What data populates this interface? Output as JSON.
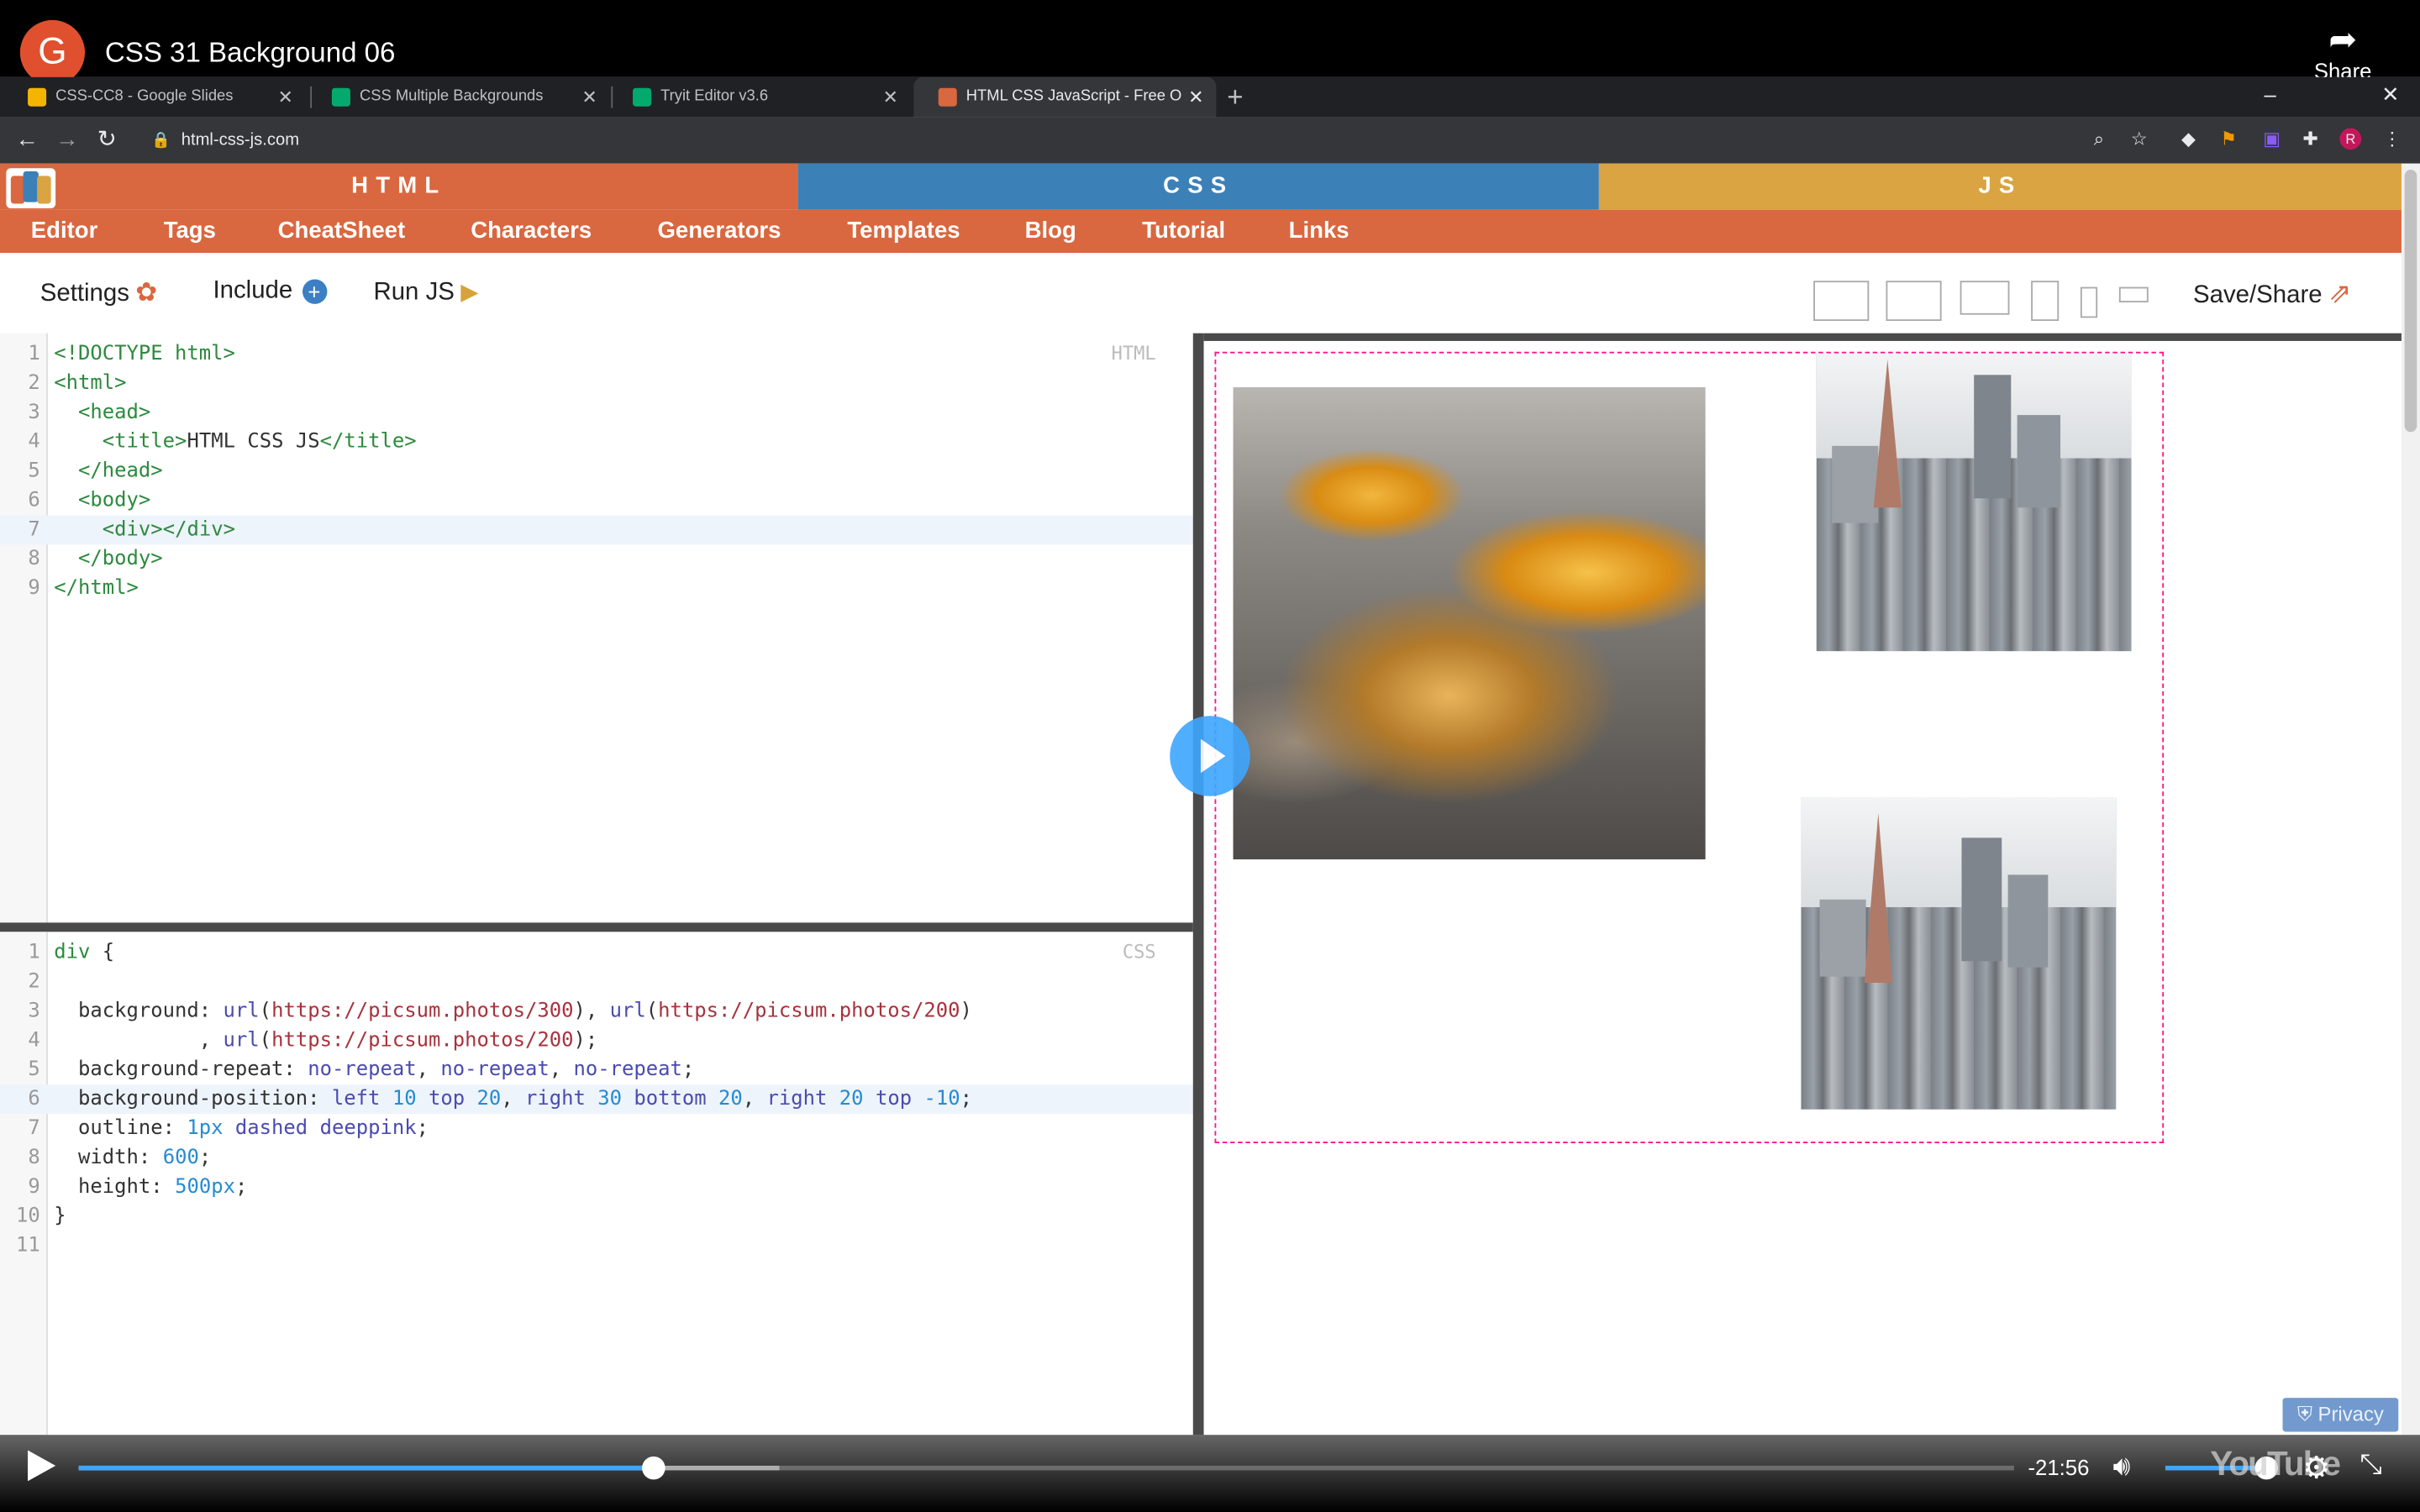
{
  "video": {
    "avatar_letter": "G",
    "title": "CSS 31 Background 06",
    "share_label": "Share",
    "time_remaining": "-21:56",
    "progress_fraction": 0.297,
    "buffered_fraction": 0.362,
    "privacy_label": "Privacy",
    "youtube_logo": "YouTube",
    "play_color": "#3ea6ff"
  },
  "browser": {
    "tabs": [
      {
        "title": "CSS-CC8 - Google Slides",
        "icon": "slides-icon",
        "color": "#f4b400",
        "active": false
      },
      {
        "title": "CSS Multiple Backgrounds",
        "icon": "w3schools-icon",
        "color": "#04aa6d",
        "active": false
      },
      {
        "title": "Tryit Editor v3.6",
        "icon": "w3schools-icon",
        "color": "#04aa6d",
        "active": false
      },
      {
        "title": "HTML CSS JavaScript - Free Onli",
        "icon": "site-icon",
        "color": "#d9673f",
        "active": true
      }
    ],
    "url": "html-css-js.com"
  },
  "site": {
    "bands": [
      {
        "label": "HTML",
        "color": "#d9673f"
      },
      {
        "label": "CSS",
        "color": "#3c80b8"
      },
      {
        "label": "JS",
        "color": "#d9a441"
      }
    ],
    "nav": [
      "Editor",
      "Tags",
      "CheatSheet",
      "Characters",
      "Generators",
      "Templates",
      "Blog",
      "Tutorial",
      "Links"
    ],
    "toolbar": {
      "settings": "Settings",
      "include": "Include",
      "run": "Run JS",
      "save_share": "Save/Share"
    }
  },
  "html_editor": {
    "label": "HTML",
    "lines": [
      "<!DOCTYPE html>",
      "<html>",
      "  <head>",
      "    <title>HTML CSS JS</title>",
      "  </head>",
      "  <body>",
      "    <div></div>",
      "  </body>",
      "</html>"
    ],
    "highlight_line": 7
  },
  "css_editor": {
    "label": "CSS",
    "lines": [
      "div {",
      "",
      "  background: url(https://picsum.photos/300), url(https://picsum.photos/200)",
      "            , url(https://picsum.photos/200);",
      "  background-repeat: no-repeat, no-repeat, no-repeat;",
      "  background-position: left 10 top 20, right 30 bottom 20, right 20 top -10;",
      "  outline: 1px dashed deeppink;",
      "  width: 600;",
      "  height: 500px;",
      "}",
      ""
    ],
    "highlight_line": 6
  }
}
